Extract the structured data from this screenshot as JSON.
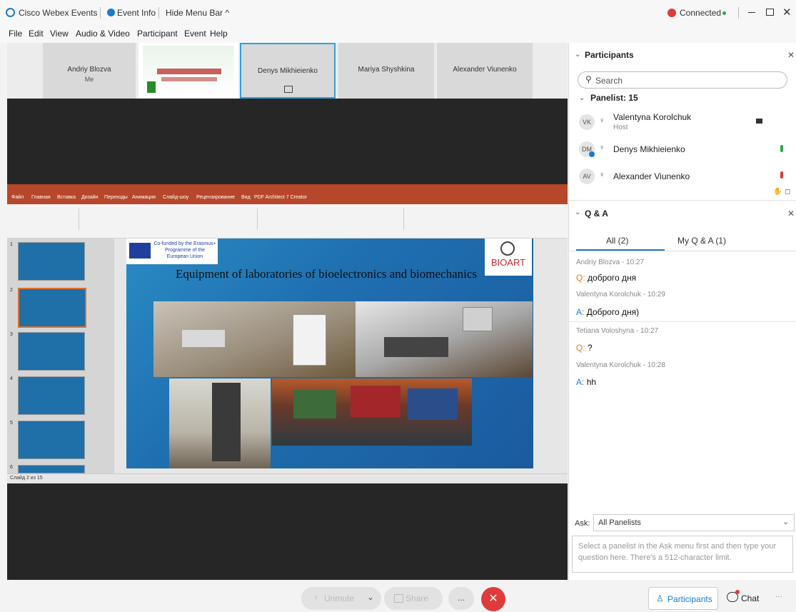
{
  "window": {
    "app_title": "Cisco Webex Events",
    "event_info": "Event Info",
    "hide_menu": "Hide Menu Bar ^",
    "connected": "Connected",
    "colors": {
      "accent": "#1a7bd1",
      "danger": "#e03b3b",
      "ppt": "#b7472a"
    }
  },
  "menu": {
    "items": [
      "File",
      "Edit",
      "View",
      "Audio & Video",
      "Participant",
      "Event",
      "Help"
    ]
  },
  "thumbnails": [
    {
      "name": "Andriy Blozva",
      "sub": "Me"
    },
    {
      "name": "",
      "sub": ""
    },
    {
      "name": "Denys Mikhieienko",
      "sub": ""
    },
    {
      "name": "Mariya Shyshkina",
      "sub": ""
    },
    {
      "name": "Alexander Viunenko",
      "sub": ""
    }
  ],
  "slide": {
    "badge": "Co-funded by the Erasmus+ Programme of the European Union",
    "logo": "BIOART",
    "title": "Equipment of laboratories of bioelectronics and biomechanics"
  },
  "ppt": {
    "tabs": [
      "Файл",
      "Главная",
      "Вставка",
      "Дизайн",
      "Переходы",
      "Анимация",
      "Слайд-шоу",
      "Рецензирование",
      "Вид",
      "PDF Architect 7 Creator"
    ],
    "slide_numbers": [
      "1",
      "2",
      "3",
      "4",
      "5",
      "6"
    ],
    "status_left": "Слайд 2 из 15"
  },
  "participants": {
    "header": "Participants",
    "search_placeholder": "Search",
    "panelist_group": "Panelist: 15",
    "list": [
      {
        "initials": "VK",
        "name": "Valentyna Korolchuk",
        "role": "Host"
      },
      {
        "initials": "DM",
        "name": "Denys Mikhieienko",
        "role": ""
      },
      {
        "initials": "AV",
        "name": "Alexander Viunenko",
        "role": ""
      }
    ]
  },
  "qa": {
    "header": "Q & A",
    "tab_all": "All (2)",
    "tab_my": "My Q & A (1)",
    "entries": [
      {
        "meta": "Andriy Blozva - 10:27",
        "prefix": "Q:",
        "text": "доброго дня",
        "type": "q"
      },
      {
        "meta": "Valentyna Korolchuk - 10:29",
        "prefix": "A:",
        "text": "Доброго дня)",
        "type": "a"
      },
      {
        "meta": "Tetiana Voloshyna - 10:27",
        "prefix": "Q:",
        "text": "?",
        "type": "q"
      },
      {
        "meta": "Valentyna Korolchuk - 10:28",
        "prefix": "A:",
        "text": "hh",
        "type": "a"
      }
    ],
    "ask_label": "Ask:",
    "ask_value": "All Panelists",
    "input_placeholder": "Select a panelist in the Ask menu first and then type your question here. There's a 512-character limit."
  },
  "controls": {
    "unmute": "Unmute",
    "share": "Share",
    "more": "...",
    "participants": "Participants",
    "chat": "Chat"
  }
}
